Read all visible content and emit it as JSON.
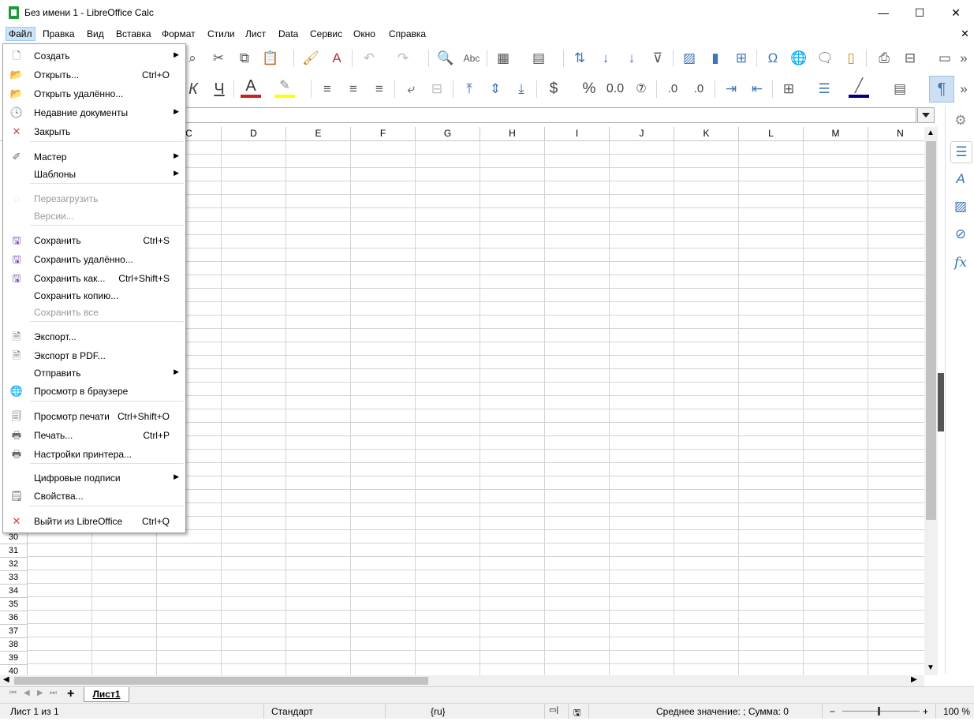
{
  "window": {
    "title": "Без имени 1 - LibreOffice Calc",
    "min": "—",
    "max": "☐",
    "close": "✕"
  },
  "menubar": [
    "Файл",
    "Правка",
    "Вид",
    "Вставка",
    "Формат",
    "Стили",
    "Лист",
    "Data",
    "Сервис",
    "Окно",
    "Справка"
  ],
  "file_menu": {
    "items": [
      {
        "label": "Создать",
        "shortcut": "",
        "submenu": true,
        "disabled": false,
        "icon": "new-doc-icon"
      },
      {
        "label": "Открыть...",
        "shortcut": "Ctrl+O",
        "submenu": false,
        "disabled": false,
        "icon": "open-folder-icon"
      },
      {
        "label": "Открыть удалённо...",
        "shortcut": "",
        "submenu": false,
        "disabled": false,
        "icon": "open-remote-icon"
      },
      {
        "label": "Недавние документы",
        "shortcut": "",
        "submenu": true,
        "disabled": false,
        "icon": "clock-icon"
      },
      {
        "label": "Закрыть",
        "shortcut": "",
        "submenu": false,
        "disabled": false,
        "icon": "close-x-icon"
      },
      {
        "label": "Мастер",
        "shortcut": "",
        "submenu": true,
        "disabled": false,
        "icon": "wizard-wand-icon"
      },
      {
        "label": "Шаблоны",
        "shortcut": "",
        "submenu": true,
        "disabled": false,
        "icon": ""
      },
      {
        "label": "Перезагрузить",
        "shortcut": "",
        "submenu": false,
        "disabled": true,
        "icon": "reload-icon"
      },
      {
        "label": "Версии...",
        "shortcut": "",
        "submenu": false,
        "disabled": true,
        "icon": ""
      },
      {
        "label": "Сохранить",
        "shortcut": "Ctrl+S",
        "submenu": false,
        "disabled": false,
        "icon": "save-icon"
      },
      {
        "label": "Сохранить удалённо...",
        "shortcut": "",
        "submenu": false,
        "disabled": false,
        "icon": "save-remote-icon"
      },
      {
        "label": "Сохранить как...",
        "shortcut": "Ctrl+Shift+S",
        "submenu": false,
        "disabled": false,
        "icon": "save-as-icon"
      },
      {
        "label": "Сохранить копию...",
        "shortcut": "",
        "submenu": false,
        "disabled": false,
        "icon": ""
      },
      {
        "label": "Сохранить все",
        "shortcut": "",
        "submenu": false,
        "disabled": true,
        "icon": ""
      },
      {
        "label": "Экспорт...",
        "shortcut": "",
        "submenu": false,
        "disabled": false,
        "icon": "export-icon"
      },
      {
        "label": "Экспорт в PDF...",
        "shortcut": "",
        "submenu": false,
        "disabled": false,
        "icon": "export-pdf-icon"
      },
      {
        "label": "Отправить",
        "shortcut": "",
        "submenu": true,
        "disabled": false,
        "icon": ""
      },
      {
        "label": "Просмотр в браузере",
        "shortcut": "",
        "submenu": false,
        "disabled": false,
        "icon": "globe-icon"
      },
      {
        "label": "Просмотр печати",
        "shortcut": "Ctrl+Shift+O",
        "submenu": false,
        "disabled": false,
        "icon": "print-preview-icon"
      },
      {
        "label": "Печать...",
        "shortcut": "Ctrl+P",
        "submenu": false,
        "disabled": false,
        "icon": "printer-icon"
      },
      {
        "label": "Настройки принтера...",
        "shortcut": "",
        "submenu": false,
        "disabled": false,
        "icon": "printer-settings-icon"
      },
      {
        "label": "Цифровые подписи",
        "shortcut": "",
        "submenu": true,
        "disabled": false,
        "icon": ""
      },
      {
        "label": "Свойства...",
        "shortcut": "",
        "submenu": false,
        "disabled": false,
        "icon": "properties-icon"
      },
      {
        "label": "Выйти из LibreOffice",
        "shortcut": "Ctrl+Q",
        "submenu": false,
        "disabled": false,
        "icon": "exit-x-icon"
      }
    ]
  },
  "columns": [
    "C",
    "D",
    "E",
    "F",
    "G",
    "H",
    "I",
    "J",
    "K",
    "L",
    "M",
    "N"
  ],
  "rows": [
    "30",
    "31",
    "32",
    "33",
    "34",
    "35",
    "36",
    "37",
    "38",
    "39",
    "40"
  ],
  "sheet_tab": "Лист1",
  "status": {
    "sheet_pos": "Лист 1 из 1",
    "page_style": "Стандарт",
    "language": "{ru}",
    "summary": "Среднее значение: ; Сумма: 0",
    "zoom": "100 %"
  },
  "toolbar": {
    "overflow": "»"
  }
}
